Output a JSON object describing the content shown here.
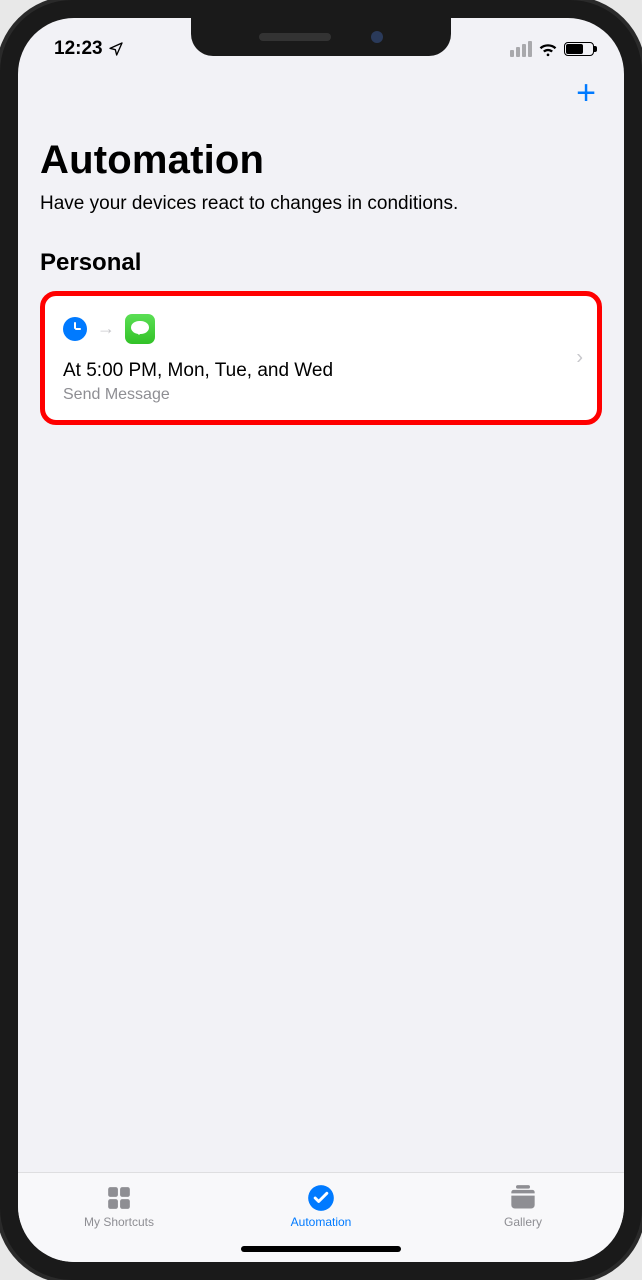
{
  "status": {
    "time": "12:23"
  },
  "header": {
    "title": "Automation",
    "subtitle": "Have your devices react to changes in conditions."
  },
  "section_title": "Personal",
  "automation": {
    "trigger_icon": "clock-icon",
    "action_icon": "messages-icon",
    "title": "At 5:00 PM, Mon, Tue, and Wed",
    "subtitle": "Send Message"
  },
  "tabs": {
    "shortcuts": "My Shortcuts",
    "automation": "Automation",
    "gallery": "Gallery"
  }
}
